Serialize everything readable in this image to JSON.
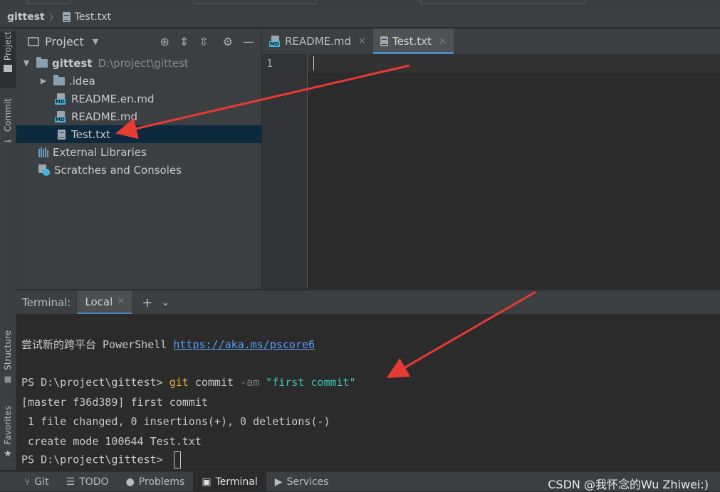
{
  "breadcrumb": {
    "project": "gittest",
    "file": "Test.txt"
  },
  "left_stripe": {
    "project": "Project",
    "commit": "Commit",
    "structure": "Structure",
    "favorites": "Favorites"
  },
  "project_panel": {
    "title": "Project",
    "tree": [
      {
        "label": "gittest",
        "detail": "D:\\project\\gittest"
      },
      {
        "label": ".idea"
      },
      {
        "label": "README.en.md"
      },
      {
        "label": "README.md"
      },
      {
        "label": "Test.txt"
      },
      {
        "label": "External Libraries"
      },
      {
        "label": "Scratches and Consoles"
      }
    ]
  },
  "editor": {
    "tabs": [
      {
        "label": "README.md"
      },
      {
        "label": "Test.txt"
      }
    ],
    "line_number": "1"
  },
  "terminal": {
    "header_label": "Terminal:",
    "tab": "Local",
    "lines": {
      "l1_text": "尝试新的跨平台 PowerShell ",
      "l1_link": "https://aka.ms/pscore6",
      "prompt": "PS D:\\project\\gittest> ",
      "cmd_git": "git",
      "cmd_commit": " commit ",
      "cmd_flag": "-am",
      "cmd_msg": " \"first commit\"",
      "l3": "[master f36d389] first commit",
      "l4": " 1 file changed, 0 insertions(+), 0 deletions(-)",
      "l5": " create mode 100644 Test.txt",
      "prompt2": "PS D:\\project\\gittest> "
    }
  },
  "status_bar": {
    "git": "Git",
    "todo": "TODO",
    "problems": "Problems",
    "terminal": "Terminal",
    "services": "Services",
    "watermark": "CSDN @我怀念的Wu Zhiwei:)"
  },
  "colors": {
    "selection": "#0d293e",
    "accent": "#4a88c7",
    "annotation_arrow": "#e83a34"
  }
}
